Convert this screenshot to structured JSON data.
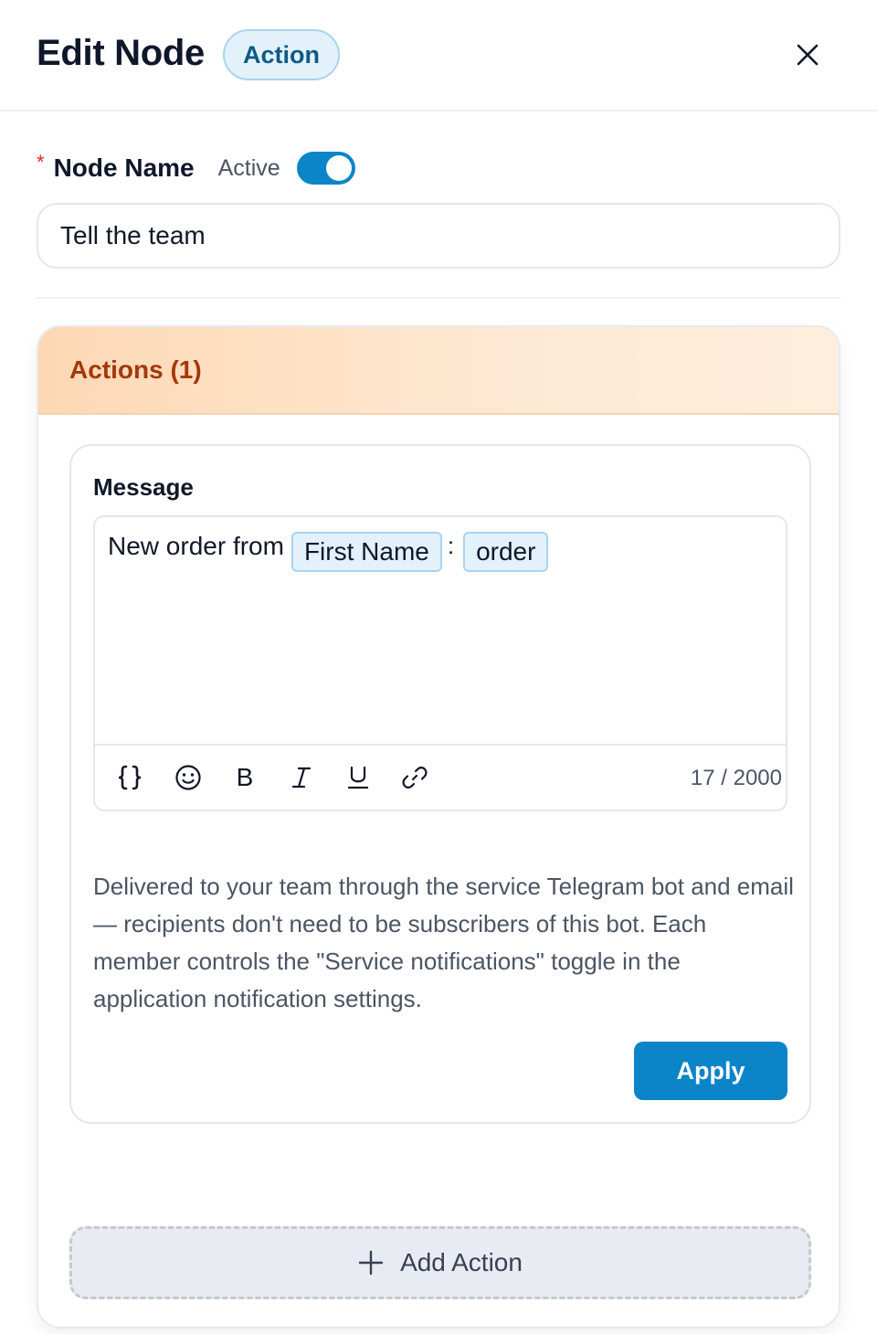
{
  "header": {
    "title": "Edit Node",
    "badge": "Action",
    "close_icon": "close-icon"
  },
  "node_name": {
    "required_mark": "*",
    "label": "Node Name",
    "active_label": "Active",
    "active": true,
    "value": "Tell the team"
  },
  "actions": {
    "title": "Actions (1)",
    "message": {
      "label": "Message",
      "text_prefix": "New order from",
      "chip_1": "First Name",
      "separator": ":",
      "chip_2": "order",
      "toolbar": [
        "variables-icon",
        "emoji-icon",
        "bold-icon",
        "italic-icon",
        "underline-icon",
        "link-icon"
      ],
      "bold_glyph": "B",
      "italic_glyph": "I",
      "underline_glyph": "U",
      "char_count": "17 / 2000",
      "help_text": "Delivered to your team through the service Telegram bot and email — recipients don't need to be subscribers of this bot. Each member controls the \"Service notifications\" toggle in the application notification settings.",
      "apply_label": "Apply"
    },
    "add_action_label": "Add Action"
  },
  "colors": {
    "accent": "#0b84c8",
    "chip_bg": "#e3f1fb",
    "actions_header": "#fdd8b4",
    "actions_title": "#a4380e",
    "required": "#dc2626"
  }
}
